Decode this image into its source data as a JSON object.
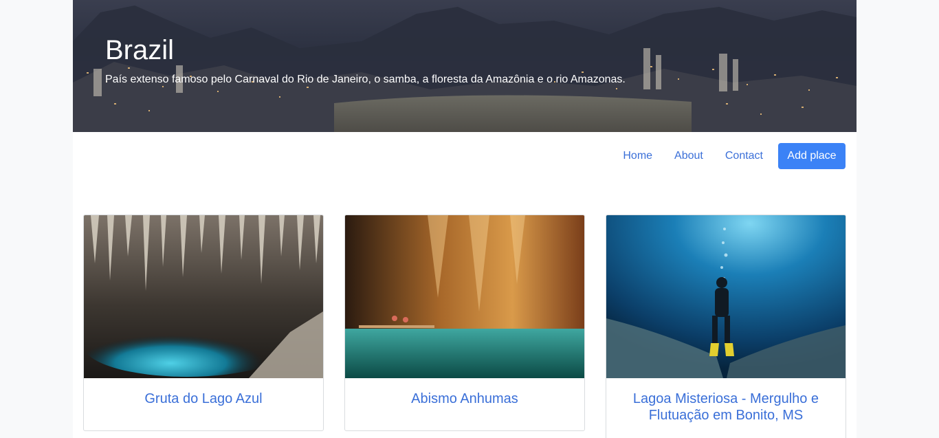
{
  "header": {
    "title": "Brazil",
    "subtitle": "País extenso famoso pelo Carnaval do Rio de Janeiro, o samba, a floresta da Amazônia e o rio Amazonas."
  },
  "nav": {
    "links": [
      "Home",
      "About",
      "Contact"
    ],
    "cta_label": "Add place"
  },
  "places": [
    {
      "title": "Gruta do Lago Azul"
    },
    {
      "title": "Abismo Anhumas"
    },
    {
      "title": "Lagoa Misteriosa - Mergulho e Flutuação em Bonito, MS"
    }
  ],
  "colors": {
    "link": "#3a6fd8",
    "button": "#3b82f6",
    "background": "#f8f9fa"
  }
}
